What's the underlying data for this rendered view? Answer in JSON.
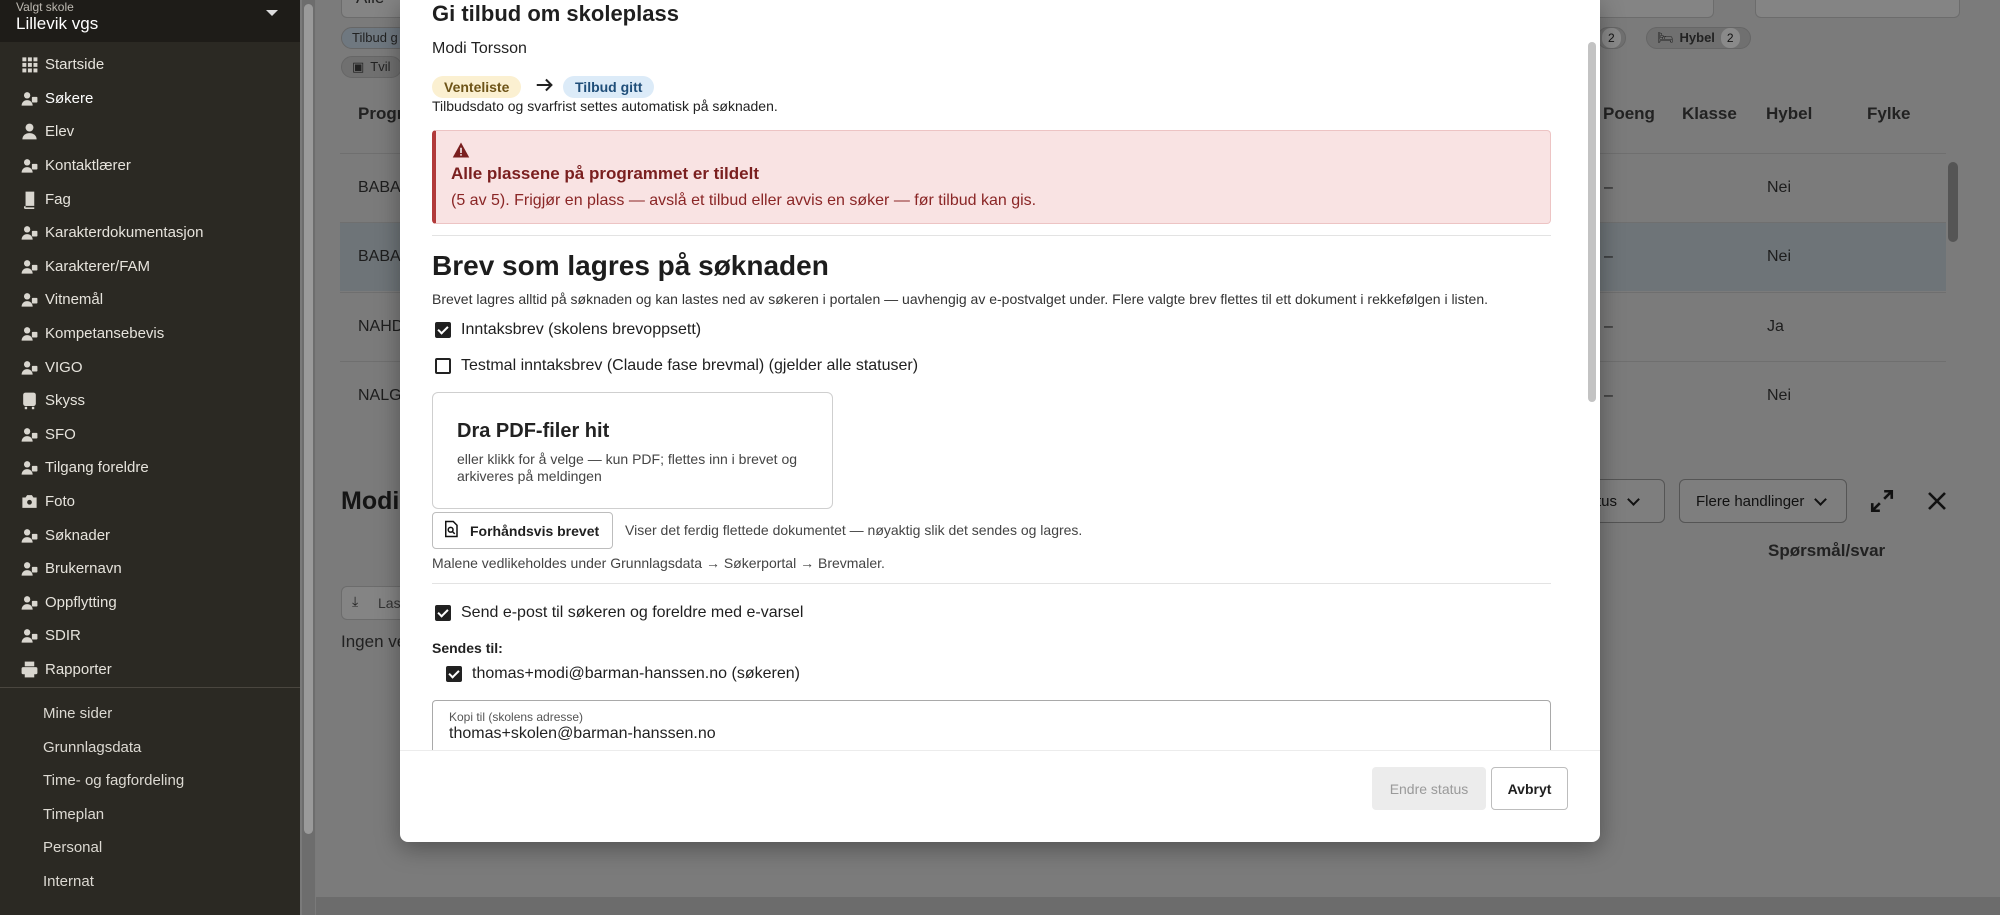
{
  "sidebar": {
    "school_label": "Valgt skole",
    "school_value": "Lillevik vgs",
    "items": [
      {
        "label": "Startside",
        "icon": "grid-icon"
      },
      {
        "label": "Søkere",
        "icon": "users-gear-icon"
      },
      {
        "label": "Elev",
        "icon": "user-icon"
      },
      {
        "label": "Kontaktlærer",
        "icon": "teacher-icon"
      },
      {
        "label": "Fag",
        "icon": "book-icon"
      },
      {
        "label": "Karakterdokumentasjon",
        "icon": "book-open-icon"
      },
      {
        "label": "Karakterer/FAM",
        "icon": "bookmark-icon"
      },
      {
        "label": "Vitnemål",
        "icon": "certificate-icon"
      },
      {
        "label": "Kompetansebevis",
        "icon": "quill-icon"
      },
      {
        "label": "VIGO",
        "icon": "arrows-exchange-icon"
      },
      {
        "label": "Skyss",
        "icon": "bus-icon"
      },
      {
        "label": "SFO",
        "icon": "child-icon"
      },
      {
        "label": "Tilgang foreldre",
        "icon": "user-shield-icon"
      },
      {
        "label": "Foto",
        "icon": "camera-icon"
      },
      {
        "label": "Søknader",
        "icon": "documents-icon"
      },
      {
        "label": "Brukernavn",
        "icon": "id-card-icon"
      },
      {
        "label": "Oppflytting",
        "icon": "stairs-icon"
      },
      {
        "label": "SDIR",
        "icon": "institution-icon"
      },
      {
        "label": "Rapporter",
        "icon": "printer-icon"
      }
    ],
    "secondary": [
      "Mine sider",
      "Grunnlagsdata",
      "Time- og fagfordeling",
      "Timeplan",
      "Personal",
      "Internat"
    ]
  },
  "background": {
    "filter_value": "Alle",
    "chip_tilbud": "Tilbud g",
    "chip_tvil": "Tvil",
    "chip_count_a": "2",
    "chip_hybel": "Hybel",
    "chip_hybel_count": "2",
    "columns": {
      "program": "Progr",
      "poeng": "Poeng",
      "klasse": "Klasse",
      "hybel": "Hybel",
      "fylke": "Fylke"
    },
    "rows": [
      {
        "prog": "BABA",
        "poeng": "–",
        "hybel": "Nei"
      },
      {
        "prog": "BABA",
        "poeng": "–",
        "hybel": "Nei"
      },
      {
        "prog": "NAHD",
        "poeng": "–",
        "hybel": "Ja"
      },
      {
        "prog": "NALG",
        "poeng": "–",
        "hybel": "Nei"
      }
    ],
    "detail_title": "Modi",
    "status_btn": "tus",
    "more_actions": "Flere handlinger",
    "tab_qa": "Spørsmål/svar",
    "download_btn": "Las",
    "empty_text": "Ingen ve"
  },
  "modal": {
    "title": "Gi tilbud om skoleplass",
    "applicant": "Modi Torsson",
    "status_from": "Venteliste",
    "status_to": "Tilbud gitt",
    "auto_note": "Tilbudsdato og svarfrist settes automatisk på søknaden.",
    "alert_title": "Alle plassene på programmet er tildelt",
    "alert_text": "(5 av 5). Frigjør en plass — avslå et tilbud eller avvis en søker — før tilbud kan gis.",
    "letters_title": "Brev som lagres på søknaden",
    "letters_desc": "Brevet lagres alltid på søknaden og kan lastes ned av søkeren i portalen — uavhengig av e-postvalget under. Flere valgte brev flettes til ett dokument i rekkefølgen i listen.",
    "letter_options": [
      {
        "label": "Inntaksbrev (skolens brevoppsett)",
        "checked": true
      },
      {
        "label": "Testmal inntaksbrev (Claude fase brevmal) (gjelder alle statuser)",
        "checked": false
      }
    ],
    "dropzone_title": "Dra PDF-filer hit",
    "dropzone_text": "eller klikk for å velge — kun PDF; flettes inn i brevet og arkiveres på meldingen",
    "preview_label": "Forhåndsvis brevet",
    "preview_note": "Viser det ferdig flettede dokumentet — nøyaktig slik det sendes og lagres.",
    "templates_note": "Malene vedlikeholdes under Grunnlagsdata → Søkerportal → Brevmaler.",
    "send_email_label": "Send e-post til søkeren og foreldre med e-varsel",
    "send_email_checked": true,
    "recipients_label": "Sendes til:",
    "recipient": "thomas+modi@barman-hanssen.no (søkeren)",
    "cc_label": "Kopi til (skolens adresse)",
    "cc_value": "thomas+skolen@barman-hanssen.no",
    "submit_label": "Endre status",
    "cancel_label": "Avbryt"
  }
}
